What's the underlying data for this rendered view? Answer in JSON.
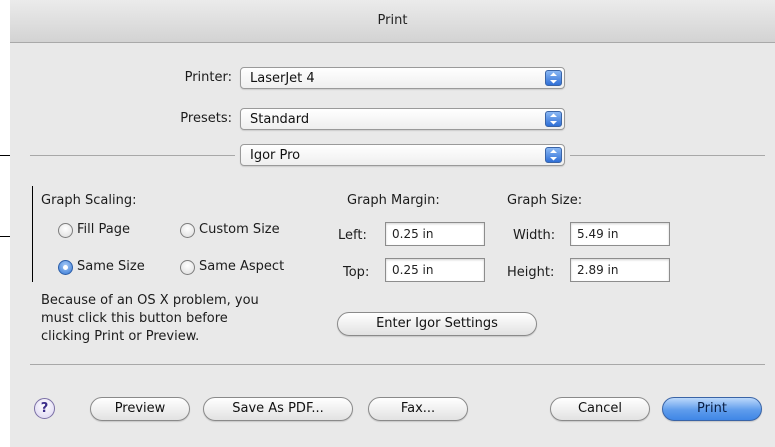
{
  "window": {
    "title": "Print"
  },
  "printer": {
    "label": "Printer:",
    "value": "LaserJet 4"
  },
  "presets": {
    "label": "Presets:",
    "value": "Standard"
  },
  "panel": {
    "value": "Igor Pro"
  },
  "scaling": {
    "heading": "Graph Scaling:",
    "options": [
      {
        "label": "Fill Page",
        "selected": false
      },
      {
        "label": "Custom Size",
        "selected": false
      },
      {
        "label": "Same Size",
        "selected": true
      },
      {
        "label": "Same Aspect",
        "selected": false
      }
    ]
  },
  "margin": {
    "heading": "Graph Margin:",
    "left_label": "Left:",
    "left_value": "0.25 in",
    "top_label": "Top:",
    "top_value": "0.25 in"
  },
  "size": {
    "heading": "Graph Size:",
    "width_label": "Width:",
    "width_value": "5.49 in",
    "height_label": "Height:",
    "height_value": "2.89 in"
  },
  "note": {
    "lines": [
      "Because of an OS X problem, you",
      "must click this button before",
      "clicking Print or Preview."
    ]
  },
  "enter_settings_label": "Enter Igor Settings",
  "footer": {
    "help": "?",
    "preview": "Preview",
    "save_pdf": "Save As PDF...",
    "fax": "Fax...",
    "cancel": "Cancel",
    "print": "Print"
  },
  "colors": {
    "dialog_bg": "#e9e9e9",
    "accent": "#3f86e6"
  },
  "icons": [
    "popup-arrows-icon",
    "radio-icon",
    "help-icon"
  ]
}
